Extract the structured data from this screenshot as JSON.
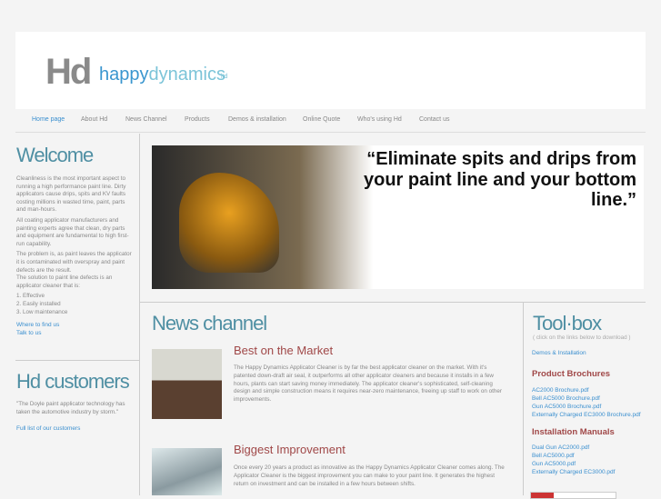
{
  "logo": {
    "hd": "Hd",
    "happy": "happy",
    "dynamics": "dynamics",
    "ltd": "ltd"
  },
  "nav": [
    "Home page",
    "About Hd",
    "News Channel",
    "Products",
    "Demos & installation",
    "Online Quote",
    "Who's using Hd",
    "Contact us"
  ],
  "welcome": {
    "title": "Welcome",
    "p1": "Cleanliness is the most important aspect to running a high performance paint line. Dirty applicators cause drips, spits and KV faults costing millions in wasted time, paint, parts and man-hours.",
    "p2": "All coating applicator manufacturers and painting experts agree that clean, dry parts and equipment are fundamental to high first-run capability.",
    "p3": "The problem is, as paint leaves the applicator it is contaminated with overspray and paint defects are the result.",
    "p4": "The solution to paint line defects is an applicator cleaner that is:",
    "list": [
      "1. Effective",
      "2. Easily installed",
      "3. Low maintenance"
    ],
    "links": [
      "Where to find us",
      "Talk to us"
    ]
  },
  "customers": {
    "title": "Hd customers",
    "quote": "\"The Doyle paint applicator technology has taken the automotive industry by storm.\"",
    "link": "Full list of our customers"
  },
  "banner": {
    "quote": "“Eliminate spits and drips from your paint line and your bottom line.”"
  },
  "news": {
    "title": "News channel",
    "items": [
      {
        "title": "Best on the Market",
        "text": "The Happy Dynamics Applicator Cleaner is by far the best applicator cleaner on the market. With it's patented down-draft air seal, it outperforms all other applicator cleaners and because it installs in a few hours, plants can start saving money immediately. The applicator cleaner's sophisticated, self-cleaning design and simple construction means it requires near-zero maintenance, freeing up staff to work on other improvements."
      },
      {
        "title": "Biggest Improvement",
        "text": "Once every 20 years a product as innovative as the Happy Dynamics Applicator Cleaner comes along. The Applicator Cleaner is the biggest improvement you can make to your paint line. It generates the highest return on investment and can be installed in a few hours between shifts."
      }
    ]
  },
  "toolbox": {
    "title": "Tool·box",
    "hint": "( click on the links below to download )",
    "demos": "Demos & Installation",
    "brochures_title": "Product Brochures",
    "brochures": [
      "AC2000 Brochure.pdf",
      "Bell AC5000 Brochure.pdf",
      "Gun AC5000 Brochure.pdf",
      "Externally Charged EC3000 Brochure.pdf"
    ],
    "manuals_title": "Installation Manuals",
    "manuals": [
      "Dual Gun AC2000.pdf",
      "Bell AC5000.pdf",
      "Gun AC5000.pdf",
      "Externally Charged EC3000.pdf"
    ]
  }
}
